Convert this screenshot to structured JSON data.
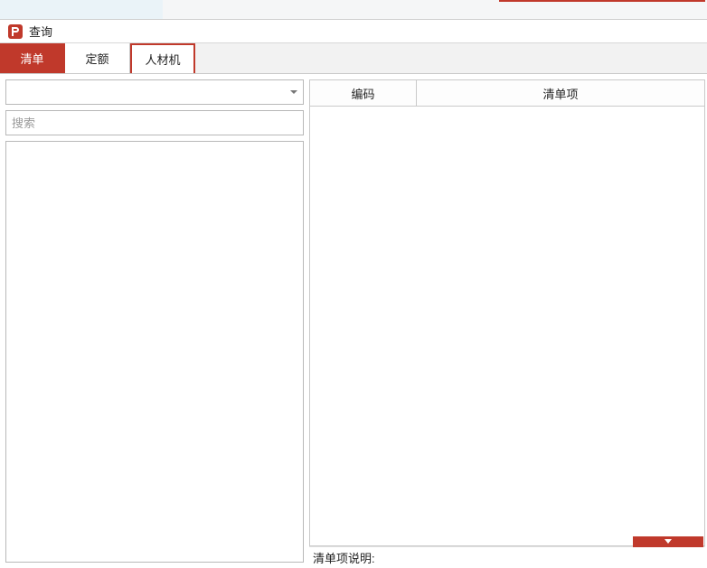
{
  "title": "查询",
  "tabs": [
    {
      "label": "清单",
      "active": true
    },
    {
      "label": "定额",
      "active": false
    },
    {
      "label": "人材机",
      "active": false,
      "outlined": true
    }
  ],
  "left": {
    "combo_value": "",
    "search_placeholder": "搜索"
  },
  "grid": {
    "col_code": "编码",
    "col_item": "清单项"
  },
  "footer": {
    "desc_label": "清单项说明:"
  }
}
